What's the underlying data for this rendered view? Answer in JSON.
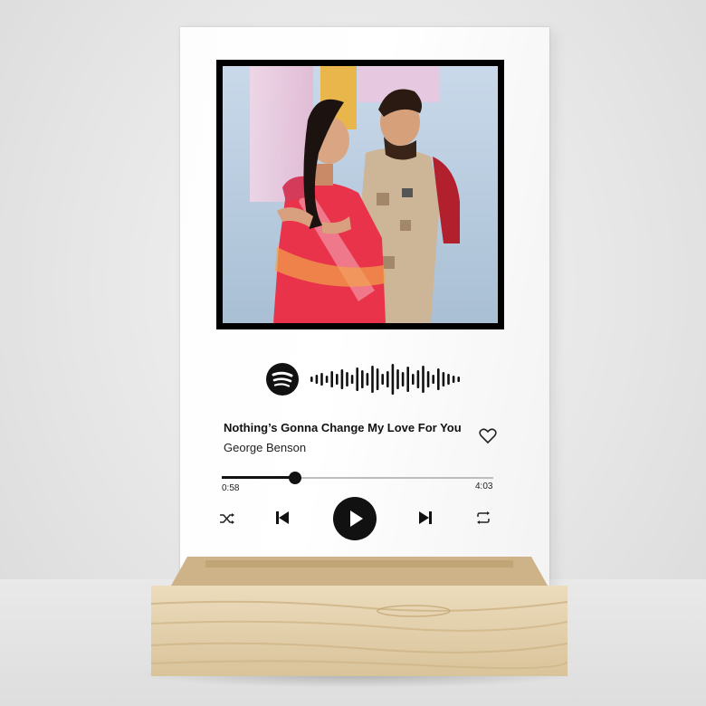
{
  "player": {
    "song_title": "Nothing’s Gonna Change My Love For You",
    "artist": "George Benson",
    "time_elapsed": "0:58",
    "time_total": "4:03",
    "progress_fraction": 0.27
  },
  "icons": {
    "brand": "spotify-logo-icon",
    "scan_code": "spotify-code-icon",
    "like": "heart-icon",
    "shuffle": "shuffle-icon",
    "previous": "skip-previous-icon",
    "play": "play-icon",
    "next": "skip-next-icon",
    "repeat": "repeat-icon"
  },
  "colors": {
    "plaque": "#ffffff",
    "ink": "#111111",
    "track": "#bdbdbd",
    "wood": "#e3cfa8",
    "saree": "#e8334a",
    "kurta": "#b21f2d"
  }
}
